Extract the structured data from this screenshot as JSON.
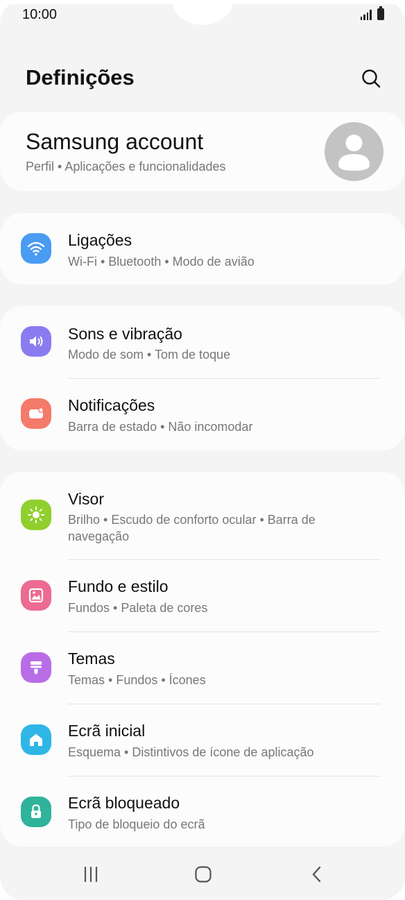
{
  "status_bar": {
    "time": "10:00"
  },
  "header": {
    "title": "Definições"
  },
  "account": {
    "title": "Samsung account",
    "subtitle": "Perfil  •  Aplicações e funcionalidades"
  },
  "settings": [
    {
      "id": "ligacoes",
      "title": "Ligações",
      "subtitle": "Wi-Fi  •  Bluetooth  •  Modo de avião",
      "icon": "wifi-icon",
      "color": "#4a9bf2"
    },
    {
      "id": "sons",
      "title": "Sons e vibração",
      "subtitle": "Modo de som  •  Tom de toque",
      "icon": "speaker-icon",
      "color": "#8a7cf0"
    },
    {
      "id": "notificacoes",
      "title": "Notificações",
      "subtitle": "Barra de estado  •  Não incomodar",
      "icon": "notification-icon",
      "color": "#f47a6a"
    },
    {
      "id": "visor",
      "title": "Visor",
      "subtitle": "Brilho  •  Escudo de conforto ocular  •  Barra de navegação",
      "icon": "sun-icon",
      "color": "#8fcf2e"
    },
    {
      "id": "fundo",
      "title": "Fundo e estilo",
      "subtitle": "Fundos  •  Paleta de cores",
      "icon": "image-icon",
      "color": "#ec6b92"
    },
    {
      "id": "temas",
      "title": "Temas",
      "subtitle": "Temas  •  Fundos  •  Ícones",
      "icon": "paintbrush-icon",
      "color": "#b86de6"
    },
    {
      "id": "ecra_inicial",
      "title": "Ecrã inicial",
      "subtitle": "Esquema  •  Distintivos de ícone de aplicação",
      "icon": "home-icon",
      "color": "#2fb6e6"
    },
    {
      "id": "ecra_bloqueado",
      "title": "Ecrã bloqueado",
      "subtitle": "Tipo de bloqueio do ecrã",
      "icon": "lock-icon",
      "color": "#2fb39a"
    }
  ]
}
